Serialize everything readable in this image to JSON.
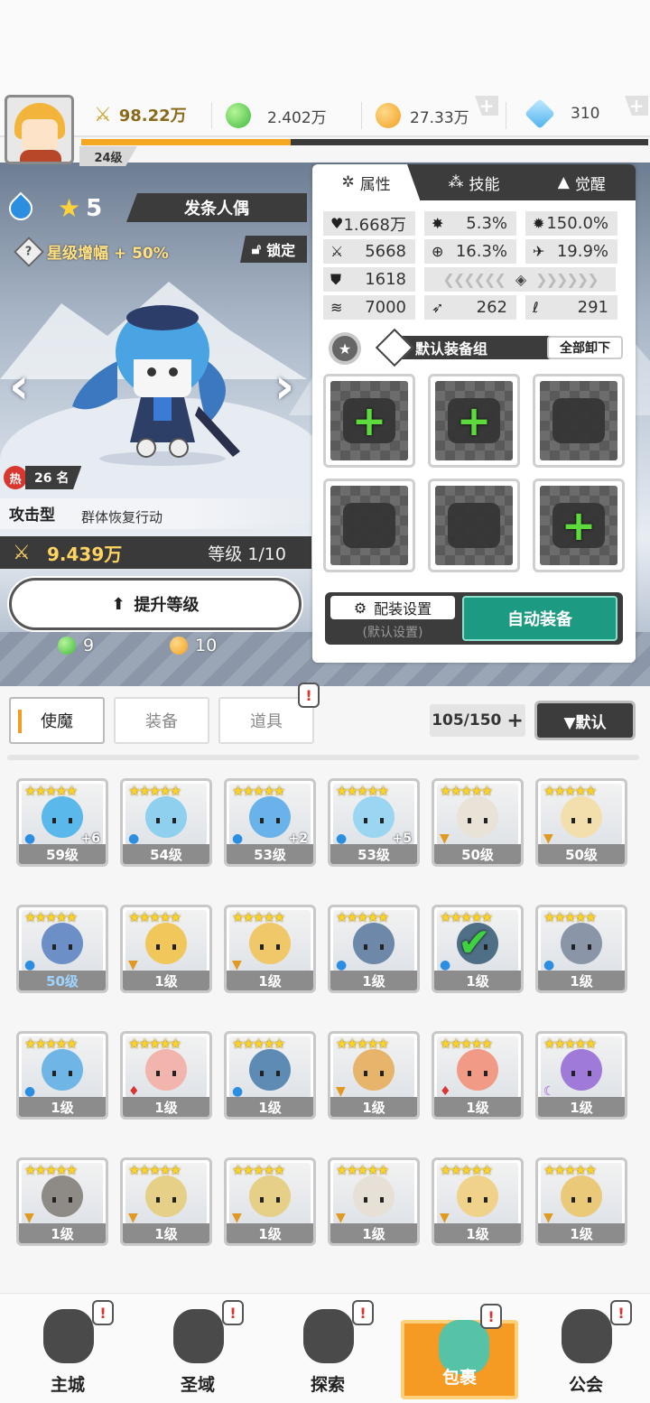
{
  "header": {
    "player_level": "24级",
    "power": "98.22万",
    "green_gem": "2.402万",
    "gold": "27.33万",
    "diamond": "310",
    "exp_progress": 0.37
  },
  "character": {
    "name": "发条人偶",
    "stars": "5",
    "star_bonus": "星级增幅 + 50%",
    "lock_label": "锁定",
    "hot_label": "热",
    "rank": "26 名",
    "type": "攻击型",
    "type_desc": "群体恢复行动",
    "power": "9.439万",
    "level": "等级 1/10",
    "upgrade_label": "提升等级",
    "cost_green": "9",
    "cost_gold": "10"
  },
  "panel": {
    "tabs": [
      {
        "label": "属性",
        "icon": "attributes-icon"
      },
      {
        "label": "技能",
        "icon": "skill-icon"
      },
      {
        "label": "觉醒",
        "icon": "awaken-icon"
      }
    ],
    "stats": {
      "hp": "1.668万",
      "crit": "5.3%",
      "crit_dmg": "150.0%",
      "atk": "5668",
      "acc": "16.3%",
      "dodge": "19.9%",
      "def": "1618",
      "speed": "7000",
      "stat_a": "262",
      "stat_b": "291"
    },
    "equip_group": "默认装备组",
    "unload_all": "全部卸下",
    "slots": [
      {
        "name": "weapon-slot",
        "empty_add": true
      },
      {
        "name": "helmet-slot",
        "empty_add": true
      },
      {
        "name": "armor-slot",
        "empty_add": false
      },
      {
        "name": "belt-slot",
        "empty_add": false
      },
      {
        "name": "necklace-slot",
        "empty_add": false
      },
      {
        "name": "accessory-slot",
        "empty_add": true
      }
    ],
    "config_label": "配装设置",
    "config_sub": "(默认设置)",
    "auto_equip": "自动装备"
  },
  "roster": {
    "tabs": [
      "使魔",
      "装备",
      "道具"
    ],
    "count": "105/150",
    "sort_label": "▼默认",
    "cards": [
      {
        "level": "59级",
        "element": "water",
        "plus": "+6",
        "color": "#5ab8ea"
      },
      {
        "level": "54级",
        "element": "water",
        "plus": "",
        "color": "#8fd0ee"
      },
      {
        "level": "53级",
        "element": "water",
        "plus": "+2",
        "color": "#6ab3ea"
      },
      {
        "level": "53级",
        "element": "water",
        "plus": "+5",
        "color": "#9ad6f2"
      },
      {
        "level": "50级",
        "element": "earth",
        "plus": "",
        "color": "#e9e2d6"
      },
      {
        "level": "50级",
        "element": "earth",
        "plus": "",
        "color": "#f3dfae"
      },
      {
        "level": "50级",
        "element": "water",
        "plus": "",
        "color": "#6d8fc7"
      },
      {
        "level": "1级",
        "element": "earth",
        "plus": "",
        "color": "#f1c75c"
      },
      {
        "level": "1级",
        "element": "earth",
        "plus": "",
        "color": "#f1c869"
      },
      {
        "level": "1级",
        "element": "water",
        "plus": "",
        "color": "#6d88a8"
      },
      {
        "level": "1级",
        "element": "water",
        "plus": "",
        "color": "#4f6f86"
      },
      {
        "level": "1级",
        "element": "water",
        "plus": "",
        "color": "#8a96a8"
      },
      {
        "level": "1级",
        "element": "water",
        "plus": "",
        "color": "#6fb6e6"
      },
      {
        "level": "1级",
        "element": "fire",
        "plus": "",
        "color": "#f2b5ae"
      },
      {
        "level": "1级",
        "element": "water",
        "plus": "",
        "color": "#5d8bb4"
      },
      {
        "level": "1级",
        "element": "earth",
        "plus": "",
        "color": "#e7b46c"
      },
      {
        "level": "1级",
        "element": "fire",
        "plus": "",
        "color": "#f19b86"
      },
      {
        "level": "1级",
        "element": "dark",
        "plus": "",
        "color": "#a07ad8"
      },
      {
        "level": "1级",
        "element": "earth",
        "plus": "",
        "color": "#8e8a86"
      },
      {
        "level": "1级",
        "element": "earth",
        "plus": "",
        "color": "#e6cf86"
      },
      {
        "level": "1级",
        "element": "earth",
        "plus": "",
        "color": "#e6cf86"
      },
      {
        "level": "1级",
        "element": "earth",
        "plus": "",
        "color": "#e6e0d6"
      },
      {
        "level": "1级",
        "element": "earth",
        "plus": "",
        "color": "#f1d28a"
      },
      {
        "level": "1级",
        "element": "earth",
        "plus": "",
        "color": "#eac978"
      }
    ]
  },
  "nav": [
    {
      "label": "主城",
      "icon": "castle-icon"
    },
    {
      "label": "圣域",
      "icon": "sanctuary-icon"
    },
    {
      "label": "探索",
      "icon": "explore-icon"
    },
    {
      "label": "包裹",
      "icon": "backpack-icon"
    },
    {
      "label": "公会",
      "icon": "guild-icon"
    }
  ],
  "colors": {
    "accent_orange": "#f59a23",
    "auto_equip_green": "#1d9a82",
    "dark_bar": "#3c3c3c"
  }
}
